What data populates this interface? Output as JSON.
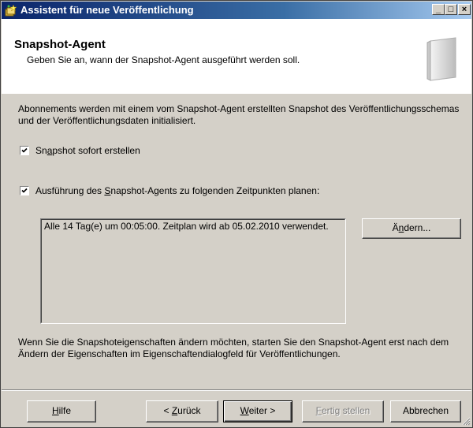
{
  "window": {
    "title": "Assistent für neue Veröffentlichung",
    "controls": {
      "minimize": "_",
      "maximize": "□",
      "close": "×"
    }
  },
  "header": {
    "title": "Snapshot-Agent",
    "subtitle": "Geben Sie an, wann der Snapshot-Agent ausgeführt werden soll.",
    "icon": "document-book-icon"
  },
  "description": "Abonnements werden mit einem vom Snapshot-Agent erstellten Snapshot des Veröffentlichungsschemas und der Veröffentlichungsdaten initialisiert.",
  "options": {
    "create_snapshot": {
      "label_pre": "Sn",
      "label_key": "a",
      "label_post": "pshot sofort erstellen",
      "checked": true
    },
    "schedule_agent": {
      "label_pre": "Ausführung des ",
      "label_key": "S",
      "label_post": "napshot-Agents zu folgenden Zeitpunkten planen:",
      "checked": true
    }
  },
  "schedule_text": "Alle 14 Tag(e) um 00:05:00. Zeitplan wird ab 05.02.2010 verwendet.",
  "change_button": {
    "pre": "Ä",
    "key": "n",
    "post": "dern..."
  },
  "note": "Wenn Sie die Snapshoteigenschaften ändern möchten, starten Sie den Snapshot-Agent erst nach dem Ändern der Eigenschaften im Eigenschaftendialogfeld für Veröffentlichungen.",
  "footer": {
    "help": {
      "key": "H",
      "post": "ilfe"
    },
    "back": {
      "pre": "< ",
      "key": "Z",
      "post": "urück"
    },
    "next": {
      "key": "W",
      "post": "eiter >"
    },
    "finish": {
      "key": "F",
      "post": "ertig stellen",
      "enabled": false
    },
    "cancel": {
      "label": "Abbrechen"
    }
  },
  "colors": {
    "titlebar_start": "#0a246a",
    "titlebar_end": "#a6caf0",
    "face": "#d4d0c8"
  }
}
